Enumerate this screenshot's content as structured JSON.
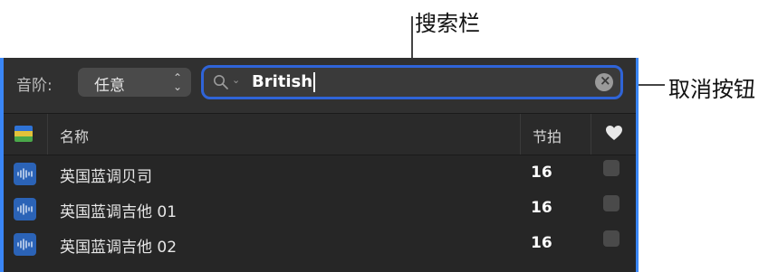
{
  "callouts": {
    "search_bar": "搜索栏",
    "cancel_search": "取消按钮"
  },
  "toolbar": {
    "scale_label": "音阶:",
    "scale_value": "任意",
    "search_value": "British"
  },
  "columns": {
    "name": "名称",
    "tempo": "节拍"
  },
  "loops": [
    {
      "name": "英国蓝调贝司",
      "tempo": "16"
    },
    {
      "name": "英国蓝调吉他 01",
      "tempo": "16"
    },
    {
      "name": "英国蓝调吉他 02",
      "tempo": "16"
    }
  ],
  "icons": {
    "search": "search-icon",
    "clear": "clear-icon",
    "favorite_header": "heart-icon",
    "audio_loop": "waveform-icon"
  },
  "colors": {
    "panel_bg": "#262626",
    "search_focus_ring": "#2f64d8",
    "loop_badge": "#2b63b7",
    "window_edge": "#3a86f6"
  }
}
